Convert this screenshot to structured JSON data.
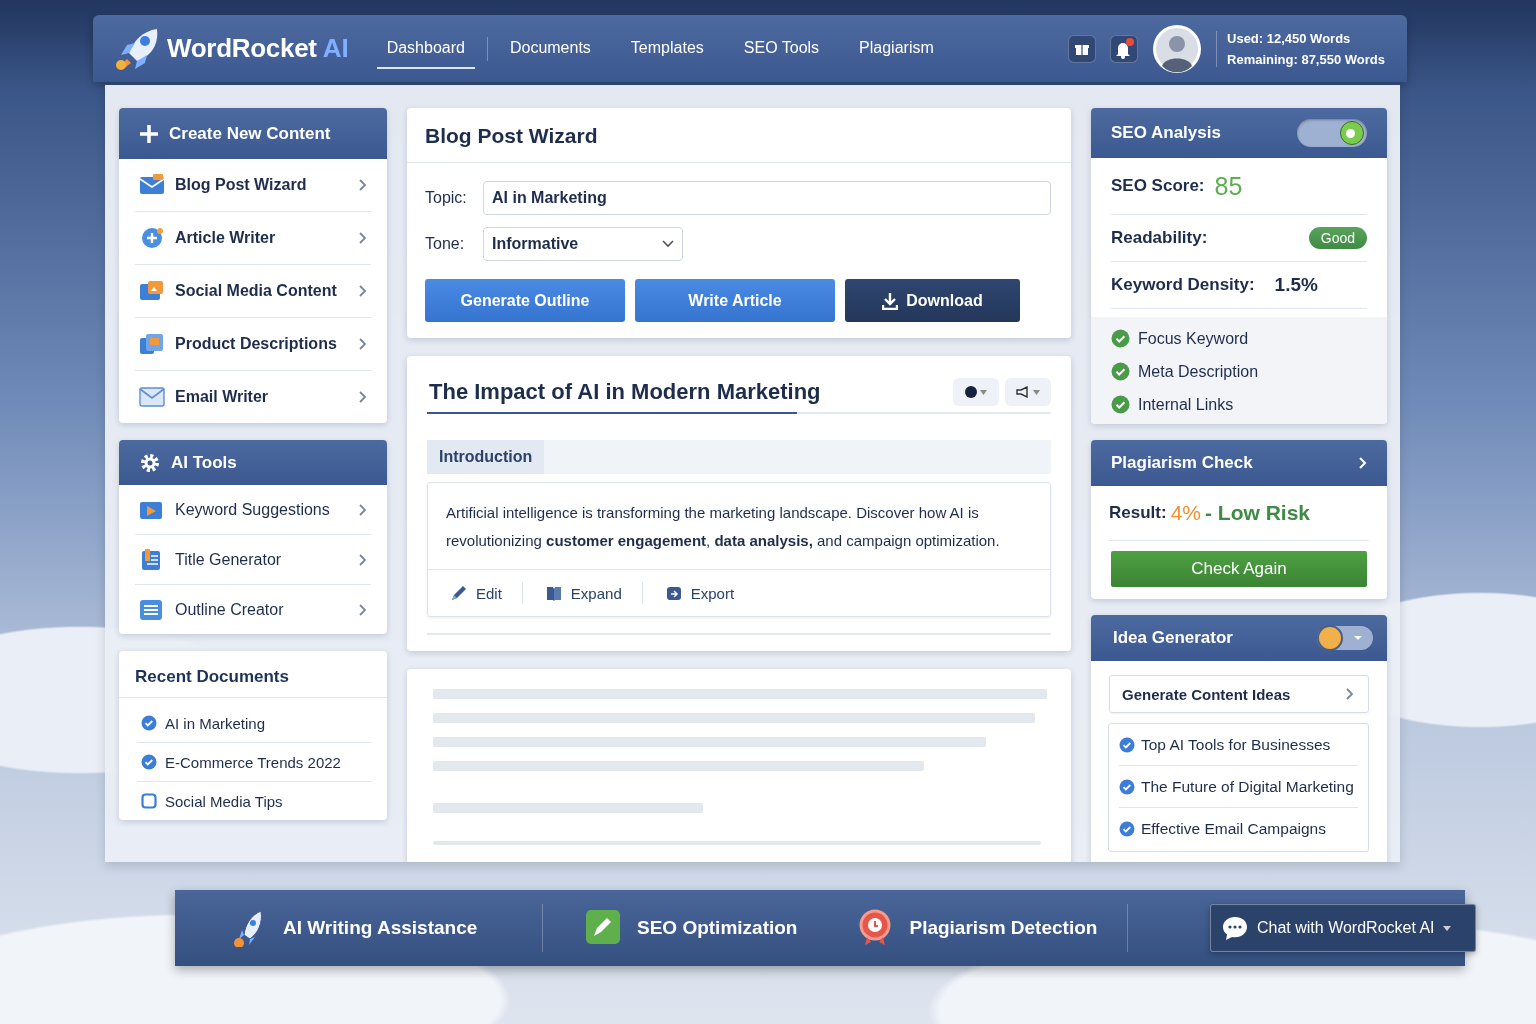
{
  "header": {
    "brand": "WordRocket",
    "brand_suffix": "AI",
    "nav": [
      {
        "label": "Dashboard",
        "selected": true
      },
      {
        "label": "Documents",
        "selected": false
      },
      {
        "label": "Templates",
        "selected": false
      },
      {
        "label": "SEO Tools",
        "selected": false
      },
      {
        "label": "Plagiarism",
        "selected": false
      }
    ],
    "usage": [
      "Used: 12,450 Words",
      "Remaining: 87,550 Words"
    ]
  },
  "create": {
    "title": "Create New Content",
    "items": [
      "Blog Post Wizard",
      "Article Writer",
      "Social Media Content",
      "Product Descriptions",
      "Email Writer"
    ]
  },
  "ai_tools": {
    "title": "AI Tools",
    "items": [
      "Keyword Suggestions",
      "Title Generator",
      "Outline Creator"
    ]
  },
  "recent": {
    "title": "Recent Documents",
    "items": [
      {
        "label": "AI in Marketing",
        "checked": true
      },
      {
        "label": "E-Commerce Trends 2022",
        "checked": true
      },
      {
        "label": "Social Media Tips",
        "checked": false
      }
    ]
  },
  "wizard": {
    "title": "Blog Post Wizard",
    "topic_label": "Topic:",
    "topic": "AI in Marketing",
    "tone_label": "Tone:",
    "tone": "Informative",
    "buttons": [
      {
        "label": "Generate Outline",
        "kind": "primary"
      },
      {
        "label": "Write Article",
        "kind": "primary"
      },
      {
        "label": "Download",
        "kind": "download"
      }
    ]
  },
  "article": {
    "title": "The Impact of AI in Modern Marketing",
    "section": "Introduction",
    "body": "Artificial intelligence is transforming the marketing landscape. Discover how AI is revolutionizing **customer engagement**, **data analysis,** and campaign optimization.",
    "actions": [
      {
        "label": "Edit",
        "kind": "edit"
      },
      {
        "label": "Expand",
        "kind": "expand"
      },
      {
        "label": "Export",
        "kind": "export"
      }
    ]
  },
  "seo": {
    "title": "SEO Analysis",
    "toggle_on": true,
    "score_label": "SEO Score:",
    "score": "85",
    "readability_label": "Readability:",
    "readability": "Good",
    "density_label": "Keyword Density:",
    "density": "1.5%",
    "checks": [
      {
        "label": "Focus Keyword",
        "checked": true
      },
      {
        "label": "Meta Description",
        "checked": true
      },
      {
        "label": "Internal Links",
        "checked": true
      }
    ]
  },
  "plagiarism": {
    "title": "Plagiarism Check",
    "result_label": "Result:",
    "percent": "4%",
    "risk": "- Low Risk",
    "button": "Check Again"
  },
  "ideas": {
    "title": "Idea Generator",
    "action": "Generate Content Ideas",
    "items": [
      {
        "label": "Top AI Tools for Businesses",
        "checked": true
      },
      {
        "label": "The Future of Digital Marketing",
        "checked": true
      },
      {
        "label": "Effective Email Campaigns",
        "checked": true
      }
    ]
  },
  "features": [
    {
      "label": "AI Writing Assistance",
      "kind": "rocket"
    },
    {
      "label": "SEO Optimization",
      "kind": "seo"
    },
    {
      "label": "Plagiarism Detection",
      "kind": "plagiarism"
    }
  ],
  "chat": {
    "label": "Chat with WordRocket AI"
  }
}
